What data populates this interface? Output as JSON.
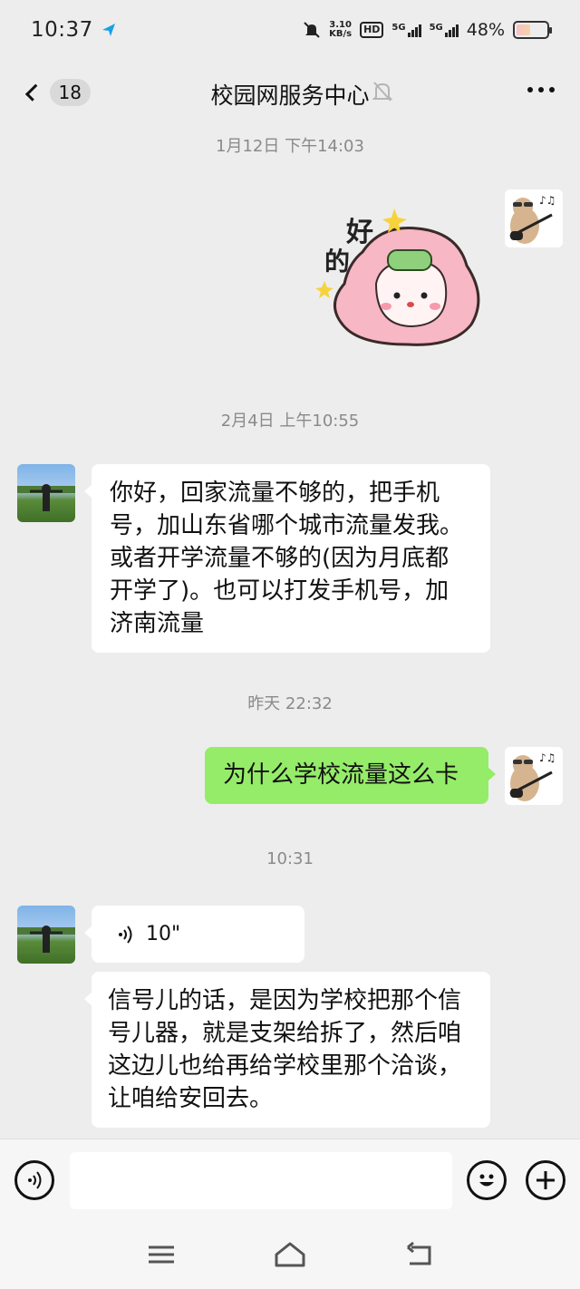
{
  "status_bar": {
    "time": "10:37",
    "net_speed_value": "3.10",
    "net_speed_unit": "KB/s",
    "hd_label": "HD",
    "sim1_label": "5G",
    "sim2_label": "5G",
    "battery_percent": "48%",
    "battery_level": 0.48
  },
  "header": {
    "unread_count": "18",
    "title": "校园网服务中心",
    "icons": [
      "back-chevron-icon",
      "mute-bell-icon",
      "more-dots-icon"
    ]
  },
  "messages": [
    {
      "kind": "timestamp",
      "text": "1月12日 下午14:03"
    },
    {
      "kind": "sticker",
      "from": "me",
      "sticker_text_1": "好",
      "sticker_text_2": "的"
    },
    {
      "kind": "timestamp",
      "text": "2月4日 上午10:55"
    },
    {
      "kind": "text",
      "from": "other",
      "text": "你好，回家流量不够的，把手机号，加山东省哪个城市流量发我。或者开学流量不够的(因为月底都开学了)。也可以打发手机号，加济南流量"
    },
    {
      "kind": "timestamp",
      "text": "昨天 22:32"
    },
    {
      "kind": "text",
      "from": "me",
      "text": "为什么学校流量这么卡"
    },
    {
      "kind": "timestamp",
      "text": "10:31"
    },
    {
      "kind": "voice",
      "from": "other",
      "duration": "10\""
    },
    {
      "kind": "text",
      "from": "other",
      "text": "信号儿的话，是因为学校把那个信号儿器，就是支架给拆了，然后咱这边儿也给再给学校里那个洽谈，让咱给安回去。"
    }
  ],
  "input_bar": {
    "placeholder": "",
    "icons": [
      "voice-input-icon",
      "emoji-icon",
      "plus-icon"
    ]
  },
  "nav_bar": {
    "icons": [
      "menu-icon",
      "home-icon",
      "back-icon"
    ]
  },
  "colors": {
    "background": "#ededed",
    "outgoing_bubble": "#95ec69",
    "incoming_bubble": "#ffffff",
    "timestamp_text": "#8a8a8a"
  }
}
